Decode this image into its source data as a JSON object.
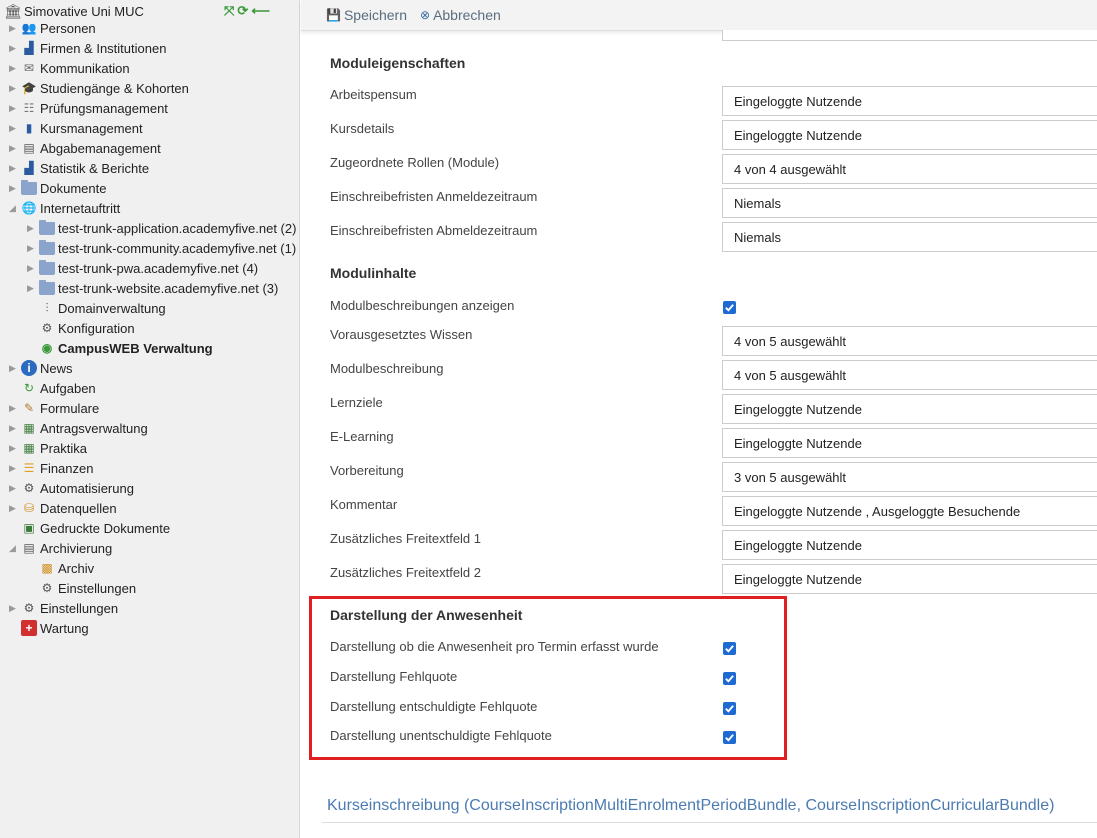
{
  "sidebar": {
    "root": {
      "label": "Simovative Uni MUC"
    },
    "items": [
      {
        "label": "Personen"
      },
      {
        "label": "Firmen & Institutionen"
      },
      {
        "label": "Kommunikation"
      },
      {
        "label": "Studiengänge & Kohorten"
      },
      {
        "label": "Prüfungsmanagement"
      },
      {
        "label": "Kursmanagement"
      },
      {
        "label": "Abgabemanagement"
      },
      {
        "label": "Statistik & Berichte"
      },
      {
        "label": "Dokumente"
      },
      {
        "label": "Internetauftritt"
      },
      {
        "label": "test-trunk-application.academyfive.net (2)"
      },
      {
        "label": "test-trunk-community.academyfive.net (1)"
      },
      {
        "label": "test-trunk-pwa.academyfive.net (4)"
      },
      {
        "label": "test-trunk-website.academyfive.net (3)"
      },
      {
        "label": "Domainverwaltung"
      },
      {
        "label": "Konfiguration"
      },
      {
        "label": "CampusWEB Verwaltung"
      },
      {
        "label": "News"
      },
      {
        "label": "Aufgaben"
      },
      {
        "label": "Formulare"
      },
      {
        "label": "Antragsverwaltung"
      },
      {
        "label": "Praktika"
      },
      {
        "label": "Finanzen"
      },
      {
        "label": "Automatisierung"
      },
      {
        "label": "Datenquellen"
      },
      {
        "label": "Gedruckte Dokumente"
      },
      {
        "label": "Archivierung"
      },
      {
        "label": "Archiv"
      },
      {
        "label": "Einstellungen"
      },
      {
        "label": "Einstellungen"
      },
      {
        "label": "Wartung"
      }
    ]
  },
  "toolbar": {
    "save_label": "Speichern",
    "cancel_label": "Abbrechen"
  },
  "sections": {
    "module_properties": {
      "title": "Moduleigenschaften",
      "rows": [
        {
          "label": "Arbeitspensum",
          "value": "Eingeloggte Nutzende"
        },
        {
          "label": "Kursdetails",
          "value": "Eingeloggte Nutzende"
        },
        {
          "label": "Zugeordnete Rollen (Module)",
          "value": "4 von 4 ausgewählt"
        },
        {
          "label": "Einschreibefristen Anmeldezeitraum",
          "value": "Niemals"
        },
        {
          "label": "Einschreibefristen Abmeldezeitraum",
          "value": "Niemals"
        }
      ]
    },
    "module_contents": {
      "title": "Modulinhalte",
      "show_descriptions_label": "Modulbeschreibungen anzeigen",
      "rows": [
        {
          "label": "Vorausgesetztes Wissen",
          "value": "4 von 5 ausgewählt"
        },
        {
          "label": "Modulbeschreibung",
          "value": "4 von 5 ausgewählt"
        },
        {
          "label": "Lernziele",
          "value": "Eingeloggte Nutzende"
        },
        {
          "label": "E-Learning",
          "value": "Eingeloggte Nutzende"
        },
        {
          "label": "Vorbereitung",
          "value": "3 von 5 ausgewählt"
        },
        {
          "label": "Kommentar",
          "value": "Eingeloggte Nutzende , Ausgeloggte Besuchende"
        },
        {
          "label": "Zusätzliches Freitextfeld 1",
          "value": "Eingeloggte Nutzende"
        },
        {
          "label": "Zusätzliches Freitextfeld 2",
          "value": "Eingeloggte Nutzende"
        }
      ]
    },
    "attendance": {
      "title": "Darstellung der Anwesenheit",
      "rows": [
        {
          "label": "Darstellung ob die Anwesenheit pro Termin erfasst wurde"
        },
        {
          "label": "Darstellung Fehlquote"
        },
        {
          "label": "Darstellung entschuldigte Fehlquote"
        },
        {
          "label": "Darstellung unentschuldigte Fehlquote"
        }
      ]
    }
  },
  "bundle_link": "Kurseinschreibung (CourseInscriptionMultiEnrolmentPeriodBundle, CourseInscriptionCurricularBundle)",
  "colors": {
    "checkbox": "#1e6ad2",
    "highlight": "#e02020",
    "link": "#4b7bb1"
  }
}
